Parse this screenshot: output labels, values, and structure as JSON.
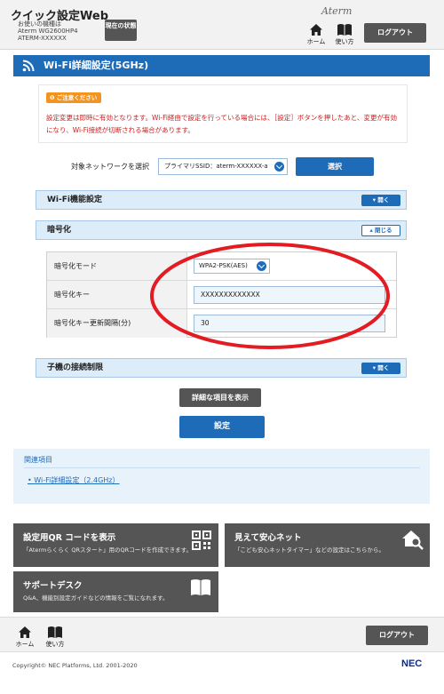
{
  "header": {
    "title": "クイック設定Web",
    "sub_label": "お使いの機種は",
    "model": "Aterm WG2600HP4",
    "ssid_name": "ATERM-XXXXXX",
    "status_btn": "現在の状態",
    "home_label": "ホーム",
    "help_label": "使い方",
    "brand": "Aterm",
    "logout_label": "ログアウト"
  },
  "page": {
    "title": "Wi-Fi詳細設定(5GHz)"
  },
  "notice": {
    "badge": "ご注意ください",
    "text": "設定変更は即時に有効となります。Wi-Fi経由で設定を行っている場合には、［設定］ボタンを押したあと、変更が有効になり、Wi-Fi接続が切断される場合があります。"
  },
  "network_select": {
    "label": "対象ネットワークを選択",
    "value": "プライマリSSID：aterm-XXXXXX-a",
    "button": "選択"
  },
  "sections": {
    "wifi_func": {
      "title": "Wi-Fi機能設定",
      "toggle": "開く"
    },
    "encryption": {
      "title": "暗号化",
      "toggle": "閉じる"
    },
    "access_limit": {
      "title": "子機の接続制限",
      "toggle": "開く"
    }
  },
  "encryption_fields": {
    "mode_label": "暗号化モード",
    "mode_value": "WPA2-PSK(AES)",
    "key_label": "暗号化キー",
    "key_value": "XXXXXXXXXXXXX",
    "interval_label": "暗号化キー更新間隔(分)",
    "interval_value": "30"
  },
  "actions": {
    "show_details": "詳細な項目を表示",
    "submit": "設定"
  },
  "related": {
    "head": "関連項目",
    "link": "Wi-Fi詳細設定（2.4GHz）"
  },
  "tiles": {
    "qr": {
      "title": "設定用QR コードを表示",
      "desc": "「Atermらくらく QRスタート」用のQRコードを作成できます。"
    },
    "safe": {
      "title": "見えて安心ネット",
      "desc": "「こども安心ネットタイマー」などの設定はこちらから。"
    },
    "support": {
      "title": "サポートデスク",
      "desc": "Q&A、機能別設定ガイドなどの情報をご覧になれます。"
    }
  },
  "footer": {
    "home_label": "ホーム",
    "help_label": "使い方",
    "logout_label": "ログアウト",
    "copyright": "Copyright© NEC Platforms, Ltd. 2001-2020",
    "nec": "NEC"
  },
  "colors": {
    "primary": "#1e6bb8",
    "dark_button": "#555555",
    "warning": "#f4931e",
    "notice_text": "#cc1d1d",
    "highlight": "#e31b23"
  }
}
